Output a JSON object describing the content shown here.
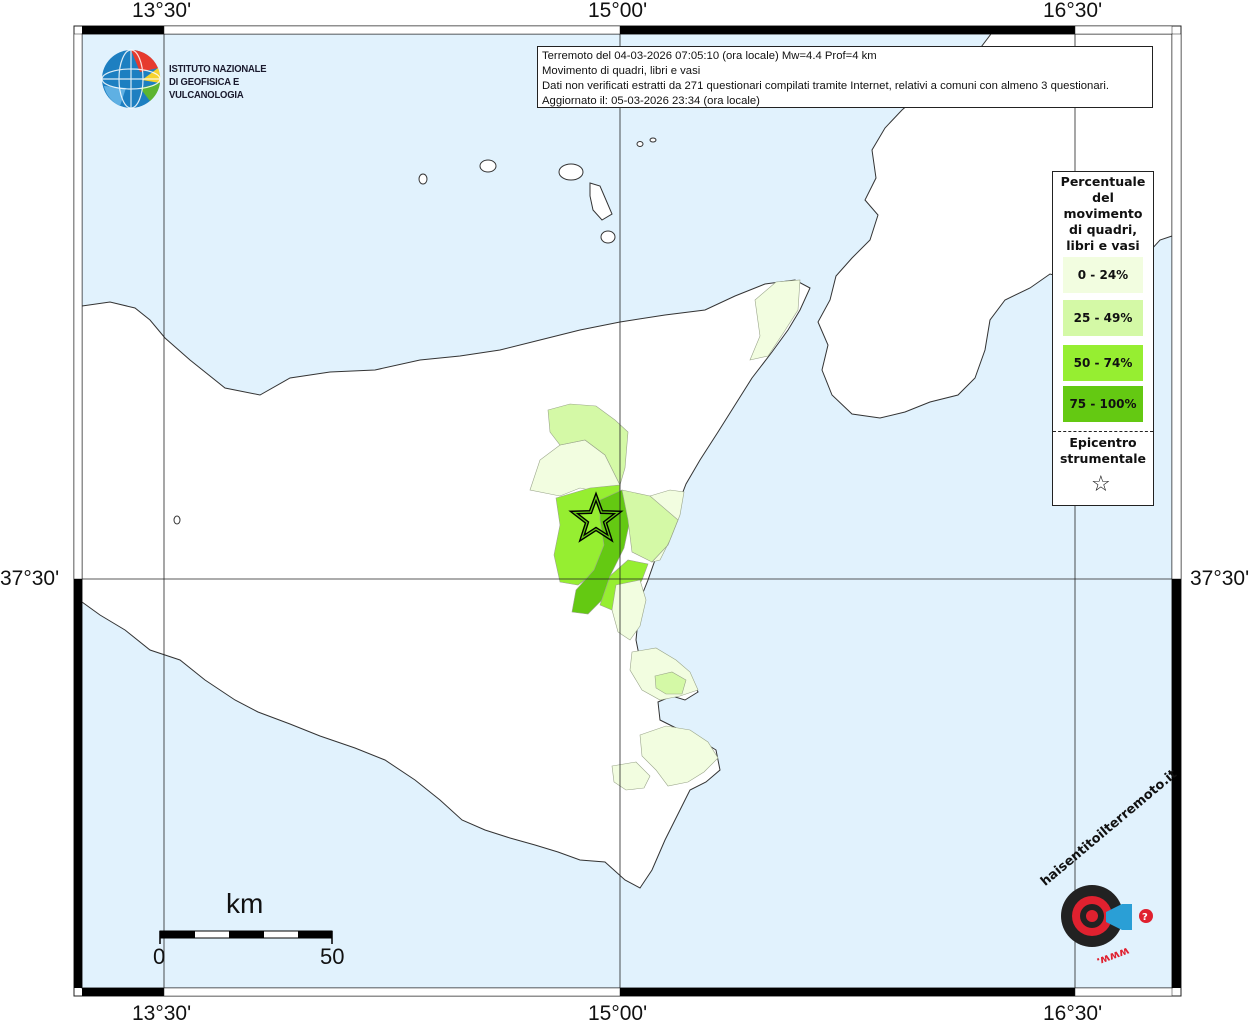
{
  "map": {
    "tick_labels": {
      "top": [
        "13°30'",
        "15°00'",
        "16°30'"
      ],
      "bottom": [
        "13°30'",
        "15°00'",
        "16°30'"
      ],
      "left": "37°30'",
      "right": "37°30'"
    },
    "colors": {
      "sea": "#e1f2fd",
      "land": "#ffffff",
      "class_0_24": "#f2fde0",
      "class_25_49": "#d4f9a6",
      "class_50_74": "#96ee31",
      "class_75_100": "#64c912"
    }
  },
  "info": {
    "line1": "Terremoto del 04-03-2026 07:05:10 (ora locale) Mw=4.4 Prof=4 km",
    "line2": "Movimento di quadri, libri e vasi",
    "line3": "Dati non verificati estratti da 271 questionari compilati tramite Internet, relativi a comuni con almeno 3 questionari.",
    "line4": "Aggiornato il: 05-03-2026 23:34 (ora locale)"
  },
  "legend": {
    "title_lines": [
      "Percentuale",
      "del",
      "movimento",
      "di quadri,",
      "libri e vasi"
    ],
    "items": [
      {
        "label": "0 - 24%",
        "color": "#f2fde0"
      },
      {
        "label": "25 - 49%",
        "color": "#d4f9a6"
      },
      {
        "label": "50 - 74%",
        "color": "#96ee31"
      },
      {
        "label": "75 - 100%",
        "color": "#64c912"
      }
    ],
    "epicenter_lines": [
      "Epicentro",
      "strumentale"
    ],
    "epicenter_symbol": "☆"
  },
  "logo": {
    "line1": "ISTITUTO NAZIONALE",
    "line2": "DI GEOFISICA E VULCANOLOGIA"
  },
  "scale": {
    "unit": "km",
    "start": "0",
    "end": "50"
  },
  "hst": {
    "text": "haisentitoilterremoto.it",
    "www": "www."
  }
}
